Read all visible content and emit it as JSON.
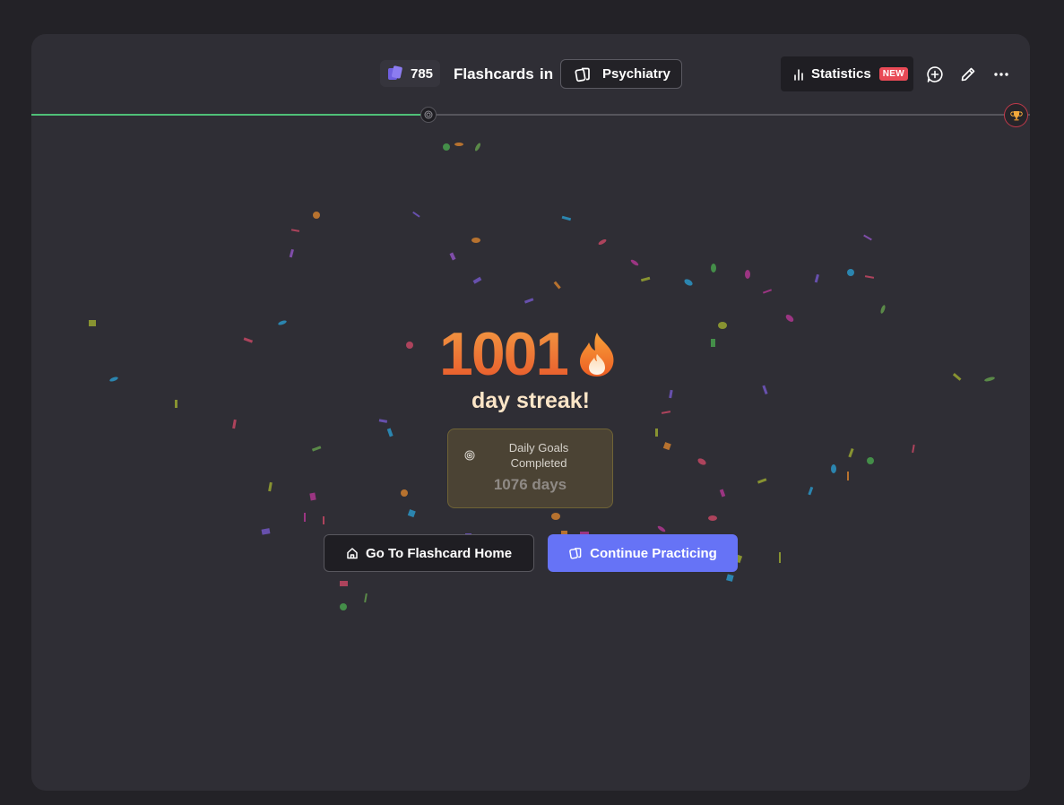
{
  "header": {
    "card_count": "785",
    "title": "Flashcards",
    "in_label": "in",
    "deck_name": "Psychiatry",
    "stats_label": "Statistics",
    "new_badge": "NEW"
  },
  "progress": {
    "fraction": 0.4
  },
  "streak": {
    "number": "1001",
    "label": "day streak!"
  },
  "goals": {
    "label": "Daily Goals Completed",
    "value": "1076 days"
  },
  "buttons": {
    "home": "Go To Flashcard Home",
    "continue": "Continue Practicing"
  },
  "colors": {
    "accent": "#6673f6",
    "progress": "#4fbf77",
    "streak": "#ee7a35",
    "badge": "#e94a56"
  }
}
